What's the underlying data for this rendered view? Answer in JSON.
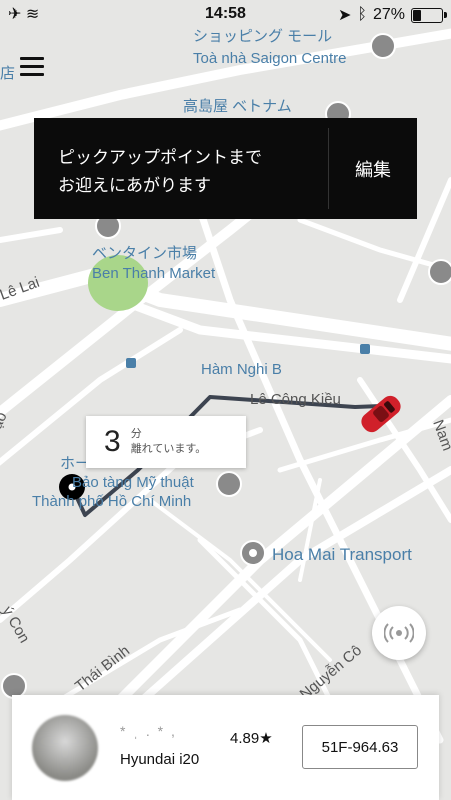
{
  "status_bar": {
    "time": "14:58",
    "battery_text": "27%",
    "battery_level": 0.27
  },
  "map_labels": {
    "shopping_mall": "ショッピング モール",
    "saigon_centre": "Toà nhà Saigon Centre",
    "takashimaya": "高島屋 ベトナム",
    "ben_thanh_jp": "ベンタイン市場",
    "ben_thanh_en": "Ben Thanh Market",
    "le_lai": "Lê Lai",
    "ham_nghi": "Hàm Nghi B",
    "le_cong_kieu": "Lê Công Kiều",
    "museum_1": "Bảo tàng Mỹ thuật",
    "museum_2": "Thành phố Hồ Chí Minh",
    "museum_prefix": "ホー",
    "hoa_mai": "Hoa Mai Transport",
    "thai_binh": "Thái Bình",
    "nguyen_co": "Nguyễn Cô",
    "ky_con": "ý Con",
    "nam": "Nam",
    "go": "ạo",
    "tiem": "店"
  },
  "banner": {
    "message_line1": "ピックアップポイントまで",
    "message_line2": "お迎えにあがります",
    "edit_label": "編集"
  },
  "eta": {
    "minutes": "3",
    "unit": "分",
    "subtext": "離れています。"
  },
  "driver": {
    "name": "* ˌ . * ,",
    "rating": "4.89★",
    "car": "Hyundai i20",
    "plate": "51F-964.63"
  },
  "icons": {
    "menu": "hamburger-icon",
    "locate": "signal-waves-icon",
    "car": "red-car-icon",
    "pickup": "pickup-pin-icon"
  },
  "colors": {
    "route": "#3d4450",
    "car": "#d0202a",
    "park": "#a9d68a",
    "poi": "#8a8a8a",
    "label_blue": "#4a7fa8"
  }
}
